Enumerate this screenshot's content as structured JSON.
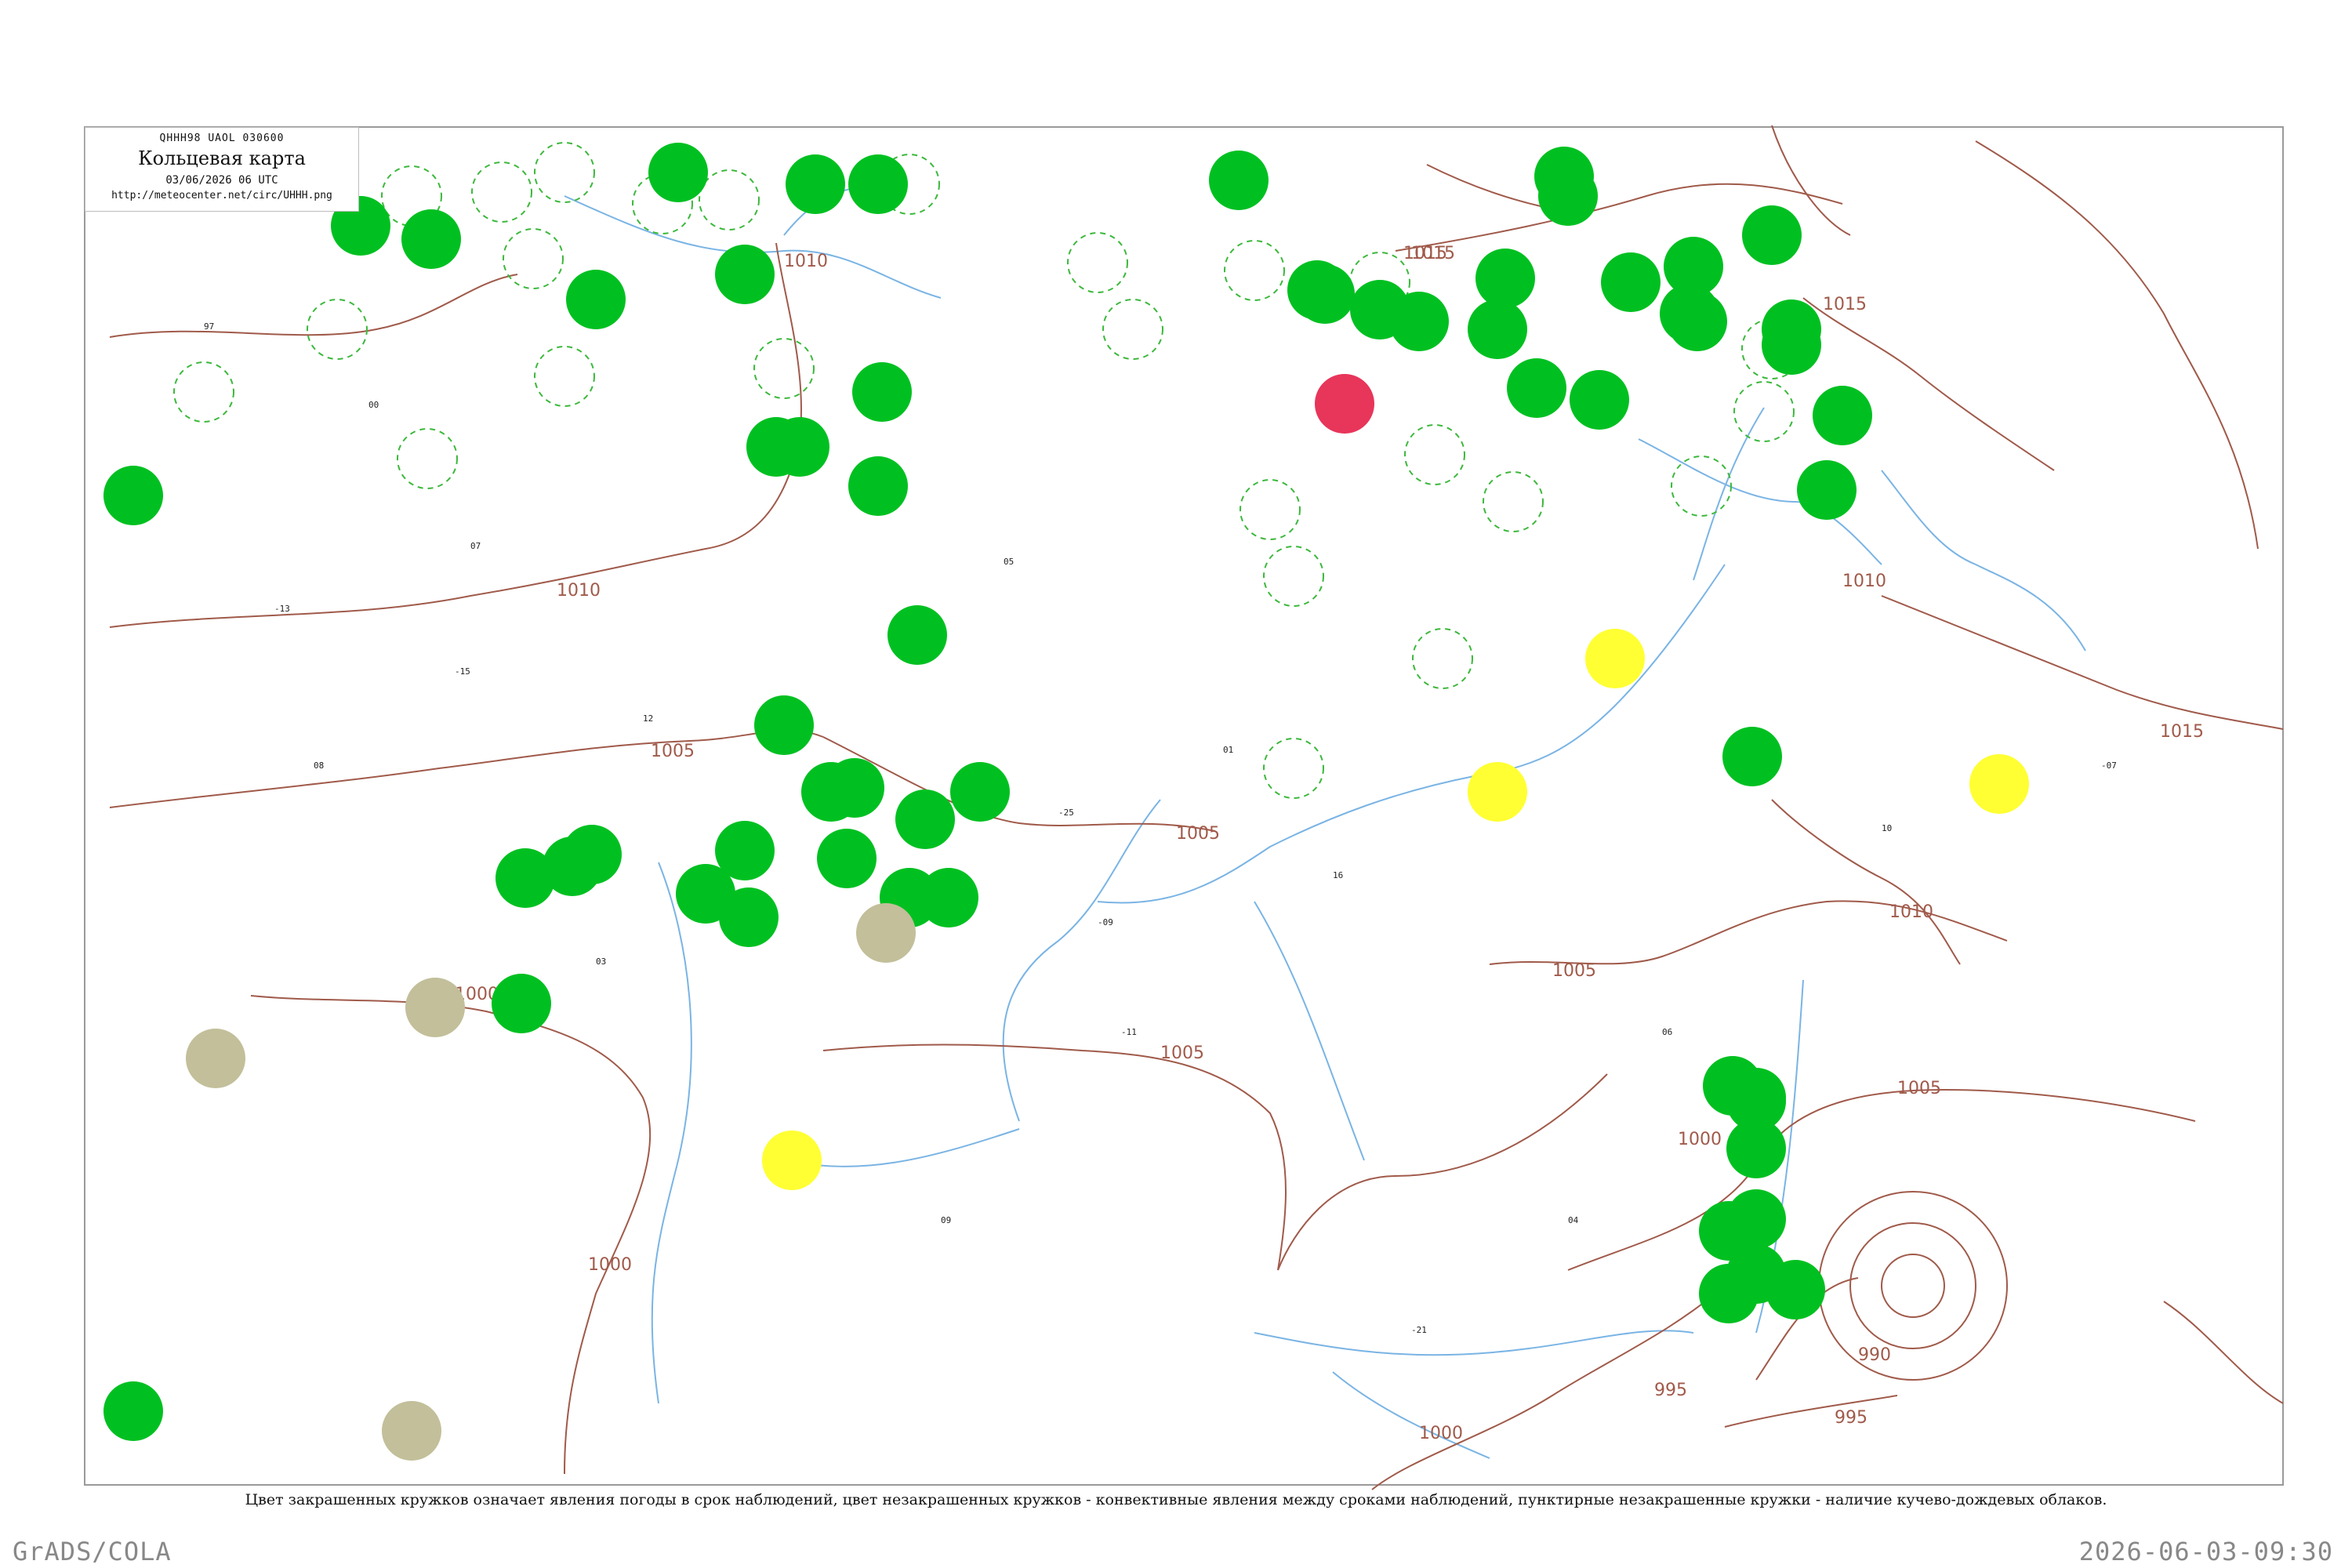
{
  "header": {
    "code_line": "QHHH98  UAOL  030600",
    "title": "Кольцевая карта",
    "date": "03/06/2026 06 UTC",
    "url": "http://meteocenter.net/circ/UHHH.png"
  },
  "caption": "Цвет закрашенных кружков означает явления погоды в срок наблюдений, цвет незакрашенных кружков - конвективные явления между сроками наблюдений, пунктирные незакрашенные кружки - наличие кучево-дождевых облаков.",
  "footer": {
    "left": "GrADS/COLA",
    "right": "2026-06-03-09:30"
  },
  "colors": {
    "filled_green": "#00c021",
    "dashed_ring": "#3cb83c",
    "yellow": "#ffff33",
    "red": "#e8355a",
    "khaki": "#c2bf9a",
    "isobar": "#a05a4a",
    "river": "#7ab4e4"
  },
  "isobar_labels": [
    "1015",
    "1010",
    "1010",
    "1010",
    "1010",
    "1005",
    "1005",
    "1005",
    "1005",
    "1005",
    "1000",
    "1000",
    "1000",
    "1000",
    "995",
    "995",
    "990",
    "1015",
    "1015",
    "1015"
  ],
  "station_codes": [
    "97",
    "00",
    "07",
    "-13",
    "-15",
    "08",
    "12",
    "03",
    "05",
    "-25",
    "01",
    "-09",
    "-11",
    "09",
    "16",
    "-21",
    "04",
    "06",
    "10",
    "-07"
  ],
  "filled_circles": [
    {
      "type": "green"
    },
    {
      "type": "green"
    },
    {
      "type": "green"
    },
    {
      "type": "green"
    },
    {
      "type": "green"
    },
    {
      "type": "green"
    },
    {
      "type": "green"
    },
    {
      "type": "green"
    },
    {
      "type": "green"
    },
    {
      "type": "green"
    },
    {
      "type": "green"
    },
    {
      "type": "green"
    },
    {
      "type": "green"
    },
    {
      "type": "green"
    },
    {
      "type": "green"
    },
    {
      "type": "green"
    },
    {
      "type": "green"
    },
    {
      "type": "green"
    },
    {
      "type": "green"
    },
    {
      "type": "green"
    },
    {
      "type": "green"
    },
    {
      "type": "green"
    },
    {
      "type": "green"
    },
    {
      "type": "green"
    },
    {
      "type": "green"
    },
    {
      "type": "green"
    },
    {
      "type": "green"
    },
    {
      "type": "green"
    },
    {
      "type": "green"
    },
    {
      "type": "green"
    },
    {
      "type": "green"
    },
    {
      "type": "green"
    },
    {
      "type": "green"
    },
    {
      "type": "green"
    },
    {
      "type": "green"
    },
    {
      "type": "green"
    },
    {
      "type": "green"
    },
    {
      "type": "green"
    },
    {
      "type": "green"
    },
    {
      "type": "green"
    },
    {
      "type": "green"
    },
    {
      "type": "green"
    },
    {
      "type": "green"
    },
    {
      "type": "green"
    },
    {
      "type": "green"
    },
    {
      "type": "green"
    },
    {
      "type": "green"
    },
    {
      "type": "green"
    },
    {
      "type": "green"
    },
    {
      "type": "green"
    },
    {
      "type": "green"
    },
    {
      "type": "green"
    },
    {
      "type": "green"
    },
    {
      "type": "green"
    },
    {
      "type": "green"
    },
    {
      "type": "green"
    },
    {
      "type": "green"
    },
    {
      "type": "green"
    },
    {
      "type": "green"
    },
    {
      "type": "yellow"
    },
    {
      "type": "yellow"
    },
    {
      "type": "yellow"
    },
    {
      "type": "yellow"
    },
    {
      "type": "red"
    },
    {
      "type": "khaki"
    },
    {
      "type": "khaki"
    },
    {
      "type": "khaki"
    },
    {
      "type": "khaki"
    }
  ]
}
